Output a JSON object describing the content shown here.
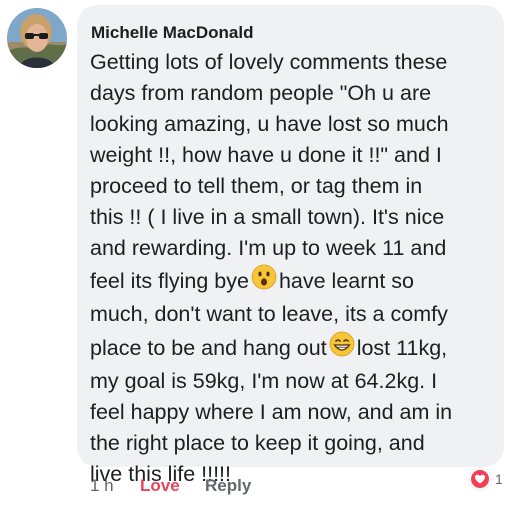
{
  "comment": {
    "author": "Michelle MacDonald",
    "lines": [
      {
        "before": "Getting lots of lovely comments these"
      },
      {
        "before": "days from random people \"Oh u are"
      },
      {
        "before": "looking amazing, u have lost so much"
      },
      {
        "before": "weight !!, how have u done it !!\" and I"
      },
      {
        "before": "proceed to tell them, or tag them in"
      },
      {
        "before": "this !! ( I live in a small town). It's nice"
      },
      {
        "before": "and rewarding. I'm up to week 11 and"
      },
      {
        "before": "feel its flying bye",
        "emoji": "surprised-face",
        "after": "have learnt so"
      },
      {
        "before": "much, don't want to leave, its a comfy"
      },
      {
        "before": "place to be and hang out",
        "emoji": "grinning-face",
        "after": "lost 11kg,"
      },
      {
        "before": "my goal is 59kg, I'm now at 64.2kg. I"
      },
      {
        "before": "feel happy where I am now, and am in"
      },
      {
        "before": "the right place to keep it going, and"
      },
      {
        "before": "live this life !!!!!"
      }
    ]
  },
  "actions": {
    "time": "1 h",
    "love_label": "Love",
    "reply_label": "Reply"
  },
  "reaction": {
    "type": "heart",
    "count": "1"
  },
  "colors": {
    "bubble": "#f0f1f3",
    "text": "#1c1e21",
    "meta": "#65676b",
    "love": "#e9445a"
  }
}
